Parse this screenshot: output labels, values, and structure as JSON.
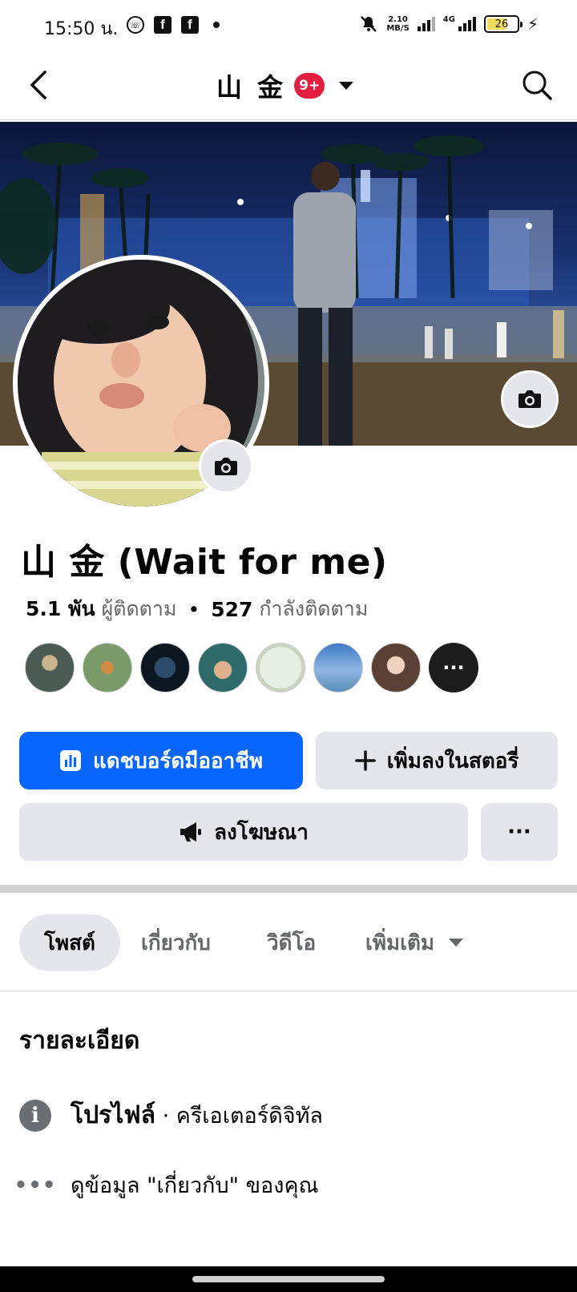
{
  "status_bar": {
    "time": "15:50 น.",
    "speed_value": "2.10",
    "speed_unit": "MB/S",
    "network": "4G",
    "battery": "26",
    "icons": [
      "whatsapp-icon",
      "facebook-icon",
      "facebook-icon",
      "dot-icon",
      "mute-icon",
      "signal-icon",
      "battery-icon",
      "charging-icon"
    ]
  },
  "header": {
    "title": "山 金",
    "badge": "9+"
  },
  "profile": {
    "name": "山 金 (Wait for me)",
    "followers_count": "5.1 พัน",
    "followers_label": "ผู้ติดตาม",
    "separator": "•",
    "following_count": "527",
    "following_label": "กำลังติดตาม",
    "friends_more": "···"
  },
  "buttons": {
    "dashboard": "แดชบอร์ดมืออาชีพ",
    "add_story": "เพิ่มลงในสตอรี่",
    "advertise": "ลงโฆษณา",
    "more": "···"
  },
  "tabs": {
    "posts": "โพสต์",
    "about": "เกี่ยวกับ",
    "videos": "วิดีโอ",
    "more": "เพิ่มเติม"
  },
  "details": {
    "title": "รายละเอียด",
    "profile_label": "โปรไฟล์",
    "profile_value": " · ครีเอเตอร์ดิจิทัล",
    "about_link": "ดูข้อมูล \"เกี่ยวกับ\" ของคุณ"
  },
  "colors": {
    "accent": "#0866ff",
    "badge": "#e41e3f",
    "button_gray": "#e4e6eb",
    "muted_text": "#65676b"
  }
}
